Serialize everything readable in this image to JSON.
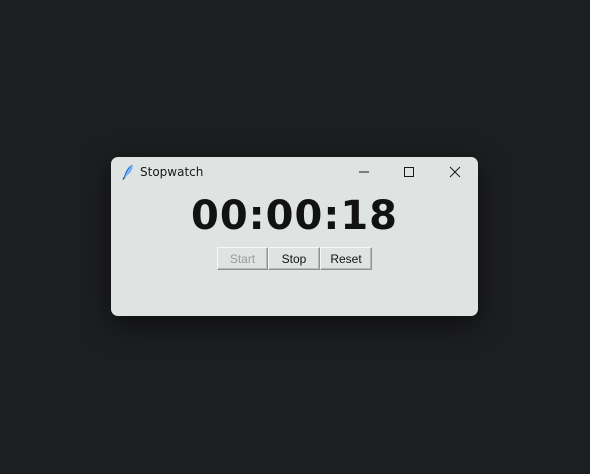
{
  "window": {
    "title": "Stopwatch",
    "icons": {
      "app": "feather-icon",
      "minimize": "minimize-icon",
      "maximize": "maximize-icon",
      "close": "close-icon"
    }
  },
  "display": {
    "time": "00:00:18"
  },
  "buttons": {
    "start_label": "Start",
    "stop_label": "Stop",
    "reset_label": "Reset",
    "start_enabled": false
  },
  "colors": {
    "desktop": "#1d1e20",
    "window_bg": "#dfe3e2",
    "text": "#121212",
    "disabled_text": "#9a9c9c",
    "icon_accent": "#1f6fd6"
  }
}
